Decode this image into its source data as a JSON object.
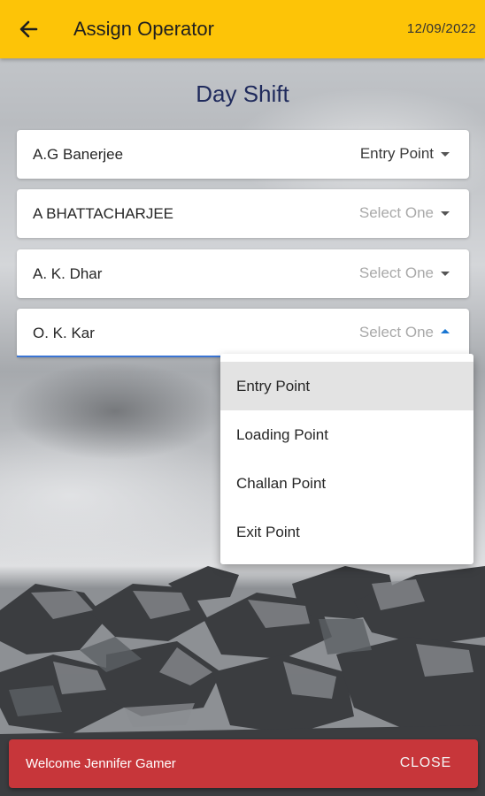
{
  "appbar": {
    "title": "Assign Operator",
    "date": "12/09/2022",
    "back_icon": "arrow-left-icon",
    "color": "#fdc407"
  },
  "shift_title": "Day Shift",
  "operators": [
    {
      "name": "A.G Banerjee",
      "selected": "Entry Point",
      "placeholder": false
    },
    {
      "name": "A BHATTACHARJEE",
      "selected": "Select One",
      "placeholder": true
    },
    {
      "name": "A. K. Dhar",
      "selected": "Select One",
      "placeholder": true
    },
    {
      "name": "O. K. Kar",
      "selected": "Select One",
      "placeholder": true,
      "open": true
    }
  ],
  "dropdown": {
    "options": [
      "Entry Point",
      "Loading Point",
      "Challan Point",
      "Exit Point"
    ],
    "highlighted": "Entry Point"
  },
  "snackbar": {
    "message": "Welcome Jennifer Gamer",
    "action": "CLOSE",
    "color": "#c7363a"
  }
}
